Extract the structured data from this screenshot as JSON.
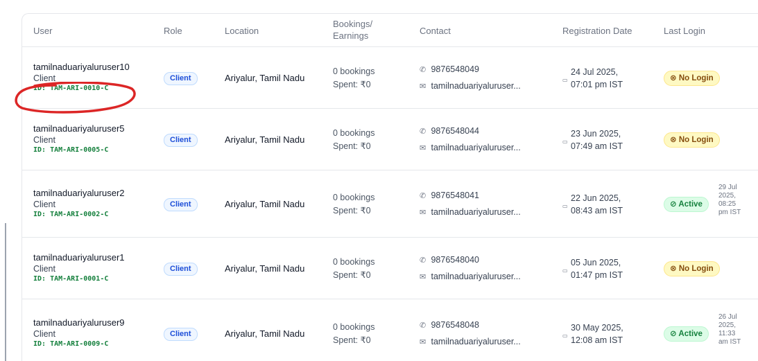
{
  "headers": {
    "user": "User",
    "role": "Role",
    "location": "Location",
    "bookings_line1": "Bookings/",
    "bookings_line2": "Earnings",
    "contact": "Contact",
    "registration": "Registration Date",
    "last_login": "Last Login"
  },
  "rows": [
    {
      "name": "tamilnaduariyaluruser10",
      "role_text": "Client",
      "id": "ID: TAM-ARI-0010-C",
      "role_badge": "Client",
      "location": "Ariyalur, Tamil Nadu",
      "bookings": "0 bookings",
      "spent": "Spent: ₹0",
      "phone": "9876548049",
      "email": "tamilnaduariyaluruser...",
      "reg_date": "24 Jul 2025,",
      "reg_time": "07:01 pm IST",
      "status": "No Login",
      "status_type": "nologin",
      "last_login": ""
    },
    {
      "name": "tamilnaduariyaluruser5",
      "role_text": "Client",
      "id": "ID: TAM-ARI-0005-C",
      "role_badge": "Client",
      "location": "Ariyalur, Tamil Nadu",
      "bookings": "0 bookings",
      "spent": "Spent: ₹0",
      "phone": "9876548044",
      "email": "tamilnaduariyaluruser...",
      "reg_date": "23 Jun 2025,",
      "reg_time": "07:49 am IST",
      "status": "No Login",
      "status_type": "nologin",
      "last_login": ""
    },
    {
      "name": "tamilnaduariyaluruser2",
      "role_text": "Client",
      "id": "ID: TAM-ARI-0002-C",
      "role_badge": "Client",
      "location": "Ariyalur, Tamil Nadu",
      "bookings": "0 bookings",
      "spent": "Spent: ₹0",
      "phone": "9876548041",
      "email": "tamilnaduariyaluruser...",
      "reg_date": "22 Jun 2025,",
      "reg_time": "08:43 am IST",
      "status": "Active",
      "status_type": "active",
      "last_login": "29 Jul 2025, 08:25 pm IST"
    },
    {
      "name": "tamilnaduariyaluruser1",
      "role_text": "Client",
      "id": "ID: TAM-ARI-0001-C",
      "role_badge": "Client",
      "location": "Ariyalur, Tamil Nadu",
      "bookings": "0 bookings",
      "spent": "Spent: ₹0",
      "phone": "9876548040",
      "email": "tamilnaduariyaluruser...",
      "reg_date": "05 Jun 2025,",
      "reg_time": "01:47 pm IST",
      "status": "No Login",
      "status_type": "nologin",
      "last_login": ""
    },
    {
      "name": "tamilnaduariyaluruser9",
      "role_text": "Client",
      "id": "ID: TAM-ARI-0009-C",
      "role_badge": "Client",
      "location": "Ariyalur, Tamil Nadu",
      "bookings": "0 bookings",
      "spent": "Spent: ₹0",
      "phone": "9876548048",
      "email": "tamilnaduariyaluruser...",
      "reg_date": "30 May 2025,",
      "reg_time": "12:08 am IST",
      "status": "Active",
      "status_type": "active",
      "last_login": "26 Jul 2025, 11:33 am IST"
    }
  ],
  "icons": {
    "phone": "phone-icon",
    "email": "mail-icon",
    "calendar": "calendar-icon",
    "nologin": "circle-x-icon",
    "active": "circle-check-icon"
  },
  "colors": {
    "id_text": "#15803d",
    "client_badge": "#1d4ed8",
    "nologin_bg": "#fef9c3",
    "active_bg": "#dcfce7",
    "annotation": "#dc2626"
  }
}
